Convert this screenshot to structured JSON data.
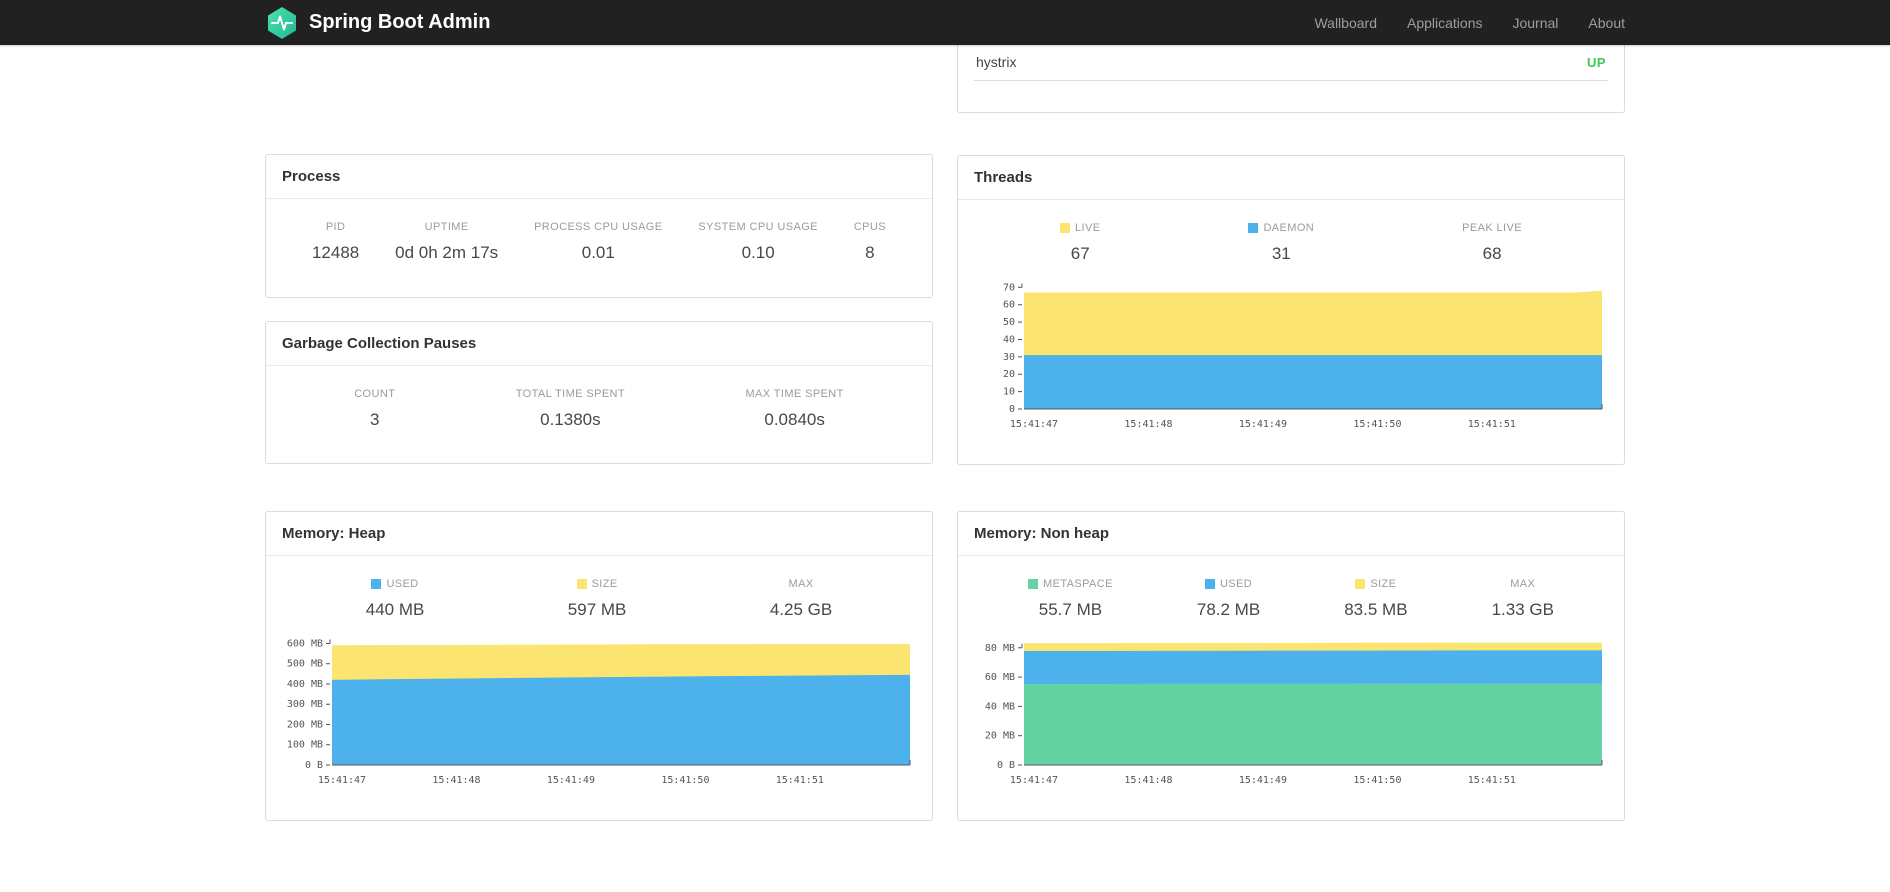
{
  "navbar": {
    "brand": "Spring Boot Admin",
    "links": [
      {
        "label": "Wallboard"
      },
      {
        "label": "Applications"
      },
      {
        "label": "Journal"
      },
      {
        "label": "About"
      }
    ]
  },
  "colors": {
    "brand_teal": "#3BD0A0",
    "status_up": "#44C553",
    "series_blue": "#4DB1EC",
    "series_yellow": "#FBE46F",
    "series_green": "#63D3A3"
  },
  "status_panel": {
    "app_name": "hystrix",
    "status": "UP"
  },
  "process": {
    "title": "Process",
    "stats": [
      {
        "label": "PID",
        "value": "12488"
      },
      {
        "label": "UPTIME",
        "value": "0d 0h 2m 17s"
      },
      {
        "label": "PROCESS CPU USAGE",
        "value": "0.01"
      },
      {
        "label": "SYSTEM CPU USAGE",
        "value": "0.10"
      },
      {
        "label": "CPUS",
        "value": "8"
      }
    ]
  },
  "gc": {
    "title": "Garbage Collection Pauses",
    "stats": [
      {
        "label": "COUNT",
        "value": "3"
      },
      {
        "label": "TOTAL TIME SPENT",
        "value": "0.1380s"
      },
      {
        "label": "MAX TIME SPENT",
        "value": "0.0840s"
      }
    ]
  },
  "threads": {
    "title": "Threads",
    "stats": [
      {
        "label": "LIVE",
        "value": "67",
        "swatch": "#FBE46F"
      },
      {
        "label": "DAEMON",
        "value": "31",
        "swatch": "#4DB1EC"
      },
      {
        "label": "PEAK LIVE",
        "value": "68"
      }
    ]
  },
  "memory_heap": {
    "title": "Memory: Heap",
    "stats": [
      {
        "label": "USED",
        "value": "440 MB",
        "swatch": "#4DB1EC"
      },
      {
        "label": "SIZE",
        "value": "597 MB",
        "swatch": "#FBE46F"
      },
      {
        "label": "MAX",
        "value": "4.25 GB"
      }
    ]
  },
  "memory_nonheap": {
    "title": "Memory: Non heap",
    "stats": [
      {
        "label": "METASPACE",
        "value": "55.7 MB",
        "swatch": "#63D3A3"
      },
      {
        "label": "USED",
        "value": "78.2 MB",
        "swatch": "#4DB1EC"
      },
      {
        "label": "SIZE",
        "value": "83.5 MB",
        "swatch": "#FBE46F"
      },
      {
        "label": "MAX",
        "value": "1.33 GB"
      }
    ]
  },
  "chart_data": [
    {
      "id": "threads",
      "type": "area",
      "title": "Threads",
      "ylim": [
        0,
        72.5
      ],
      "y_ticks": [
        {
          "v": 70,
          "label": "70"
        },
        {
          "v": 60,
          "label": "60"
        },
        {
          "v": 50,
          "label": "50"
        },
        {
          "v": 40,
          "label": "40"
        },
        {
          "v": 30,
          "label": "30"
        },
        {
          "v": 20,
          "label": "20"
        },
        {
          "v": 10,
          "label": "10"
        },
        {
          "v": 0,
          "label": "0"
        }
      ],
      "x_labels": [
        "15:41:47",
        "15:41:48",
        "15:41:49",
        "15:41:50",
        "15:41:51"
      ],
      "series": [
        {
          "name": "LIVE",
          "color": "#FBE46F",
          "values": [
            67,
            67,
            67,
            67,
            67,
            67,
            67,
            67,
            67,
            67,
            67,
            67,
            67,
            67,
            67,
            67,
            67,
            67,
            67,
            67,
            68
          ]
        },
        {
          "name": "DAEMON",
          "color": "#4DB1EC",
          "values": [
            31,
            31
          ]
        }
      ]
    },
    {
      "id": "memory-heap",
      "type": "area",
      "title": "Memory: Heap",
      "ylim": [
        0,
        622
      ],
      "y_ticks": [
        {
          "v": 600,
          "label": "600 MB"
        },
        {
          "v": 500,
          "label": "500 MB"
        },
        {
          "v": 400,
          "label": "400 MB"
        },
        {
          "v": 300,
          "label": "300 MB"
        },
        {
          "v": 200,
          "label": "200 MB"
        },
        {
          "v": 100,
          "label": "100 MB"
        },
        {
          "v": 0,
          "label": "0 B"
        }
      ],
      "x_labels": [
        "15:41:47",
        "15:41:48",
        "15:41:49",
        "15:41:50",
        "15:41:51"
      ],
      "series": [
        {
          "name": "SIZE",
          "color": "#FBE46F",
          "values": [
            591,
            592,
            593,
            594,
            595,
            596,
            596,
            597,
            597,
            597
          ]
        },
        {
          "name": "USED",
          "color": "#4DB1EC",
          "values": [
            420,
            424,
            427,
            430,
            433,
            436,
            439,
            441,
            443,
            445
          ]
        }
      ]
    },
    {
      "id": "memory-nonheap",
      "type": "area",
      "title": "Memory: Non heap",
      "ylim": [
        0,
        86
      ],
      "y_ticks": [
        {
          "v": 80,
          "label": "80 MB"
        },
        {
          "v": 60,
          "label": "60 MB"
        },
        {
          "v": 40,
          "label": "40 MB"
        },
        {
          "v": 20,
          "label": "20 MB"
        },
        {
          "v": 0,
          "label": "0 B"
        }
      ],
      "x_labels": [
        "15:41:47",
        "15:41:48",
        "15:41:49",
        "15:41:50",
        "15:41:51"
      ],
      "series": [
        {
          "name": "SIZE",
          "color": "#FBE46F",
          "values": [
            83.1,
            83.2,
            83.3,
            83.4,
            83.4,
            83.5
          ]
        },
        {
          "name": "USED",
          "color": "#4DB1EC",
          "values": [
            77.8,
            77.9,
            78.0,
            78.1,
            78.2,
            78.2
          ]
        },
        {
          "name": "METASPACE",
          "color": "#63D3A3",
          "values": [
            55.3,
            55.4,
            55.5,
            55.6,
            55.7,
            55.7
          ]
        }
      ]
    }
  ]
}
